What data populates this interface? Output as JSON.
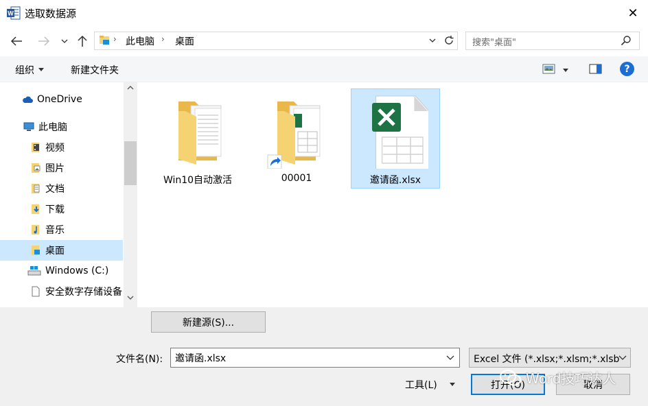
{
  "window": {
    "title": "选取数据源",
    "close_glyph": "✕",
    "app_icon_letter": "W"
  },
  "address": {
    "crumbs": [
      "此电脑",
      "桌面"
    ],
    "search_placeholder": "搜索\"桌面\""
  },
  "toolbar": {
    "organize_label": "组织",
    "new_folder_label": "新建文件夹",
    "help_label": "?"
  },
  "sidebar": {
    "items": [
      {
        "label": "OneDrive",
        "icon": "cloud-icon"
      },
      {
        "label": "此电脑",
        "icon": "computer-icon"
      },
      {
        "label": "视频",
        "icon": "video-folder-icon"
      },
      {
        "label": "图片",
        "icon": "pictures-folder-icon"
      },
      {
        "label": "文档",
        "icon": "documents-folder-icon"
      },
      {
        "label": "下载",
        "icon": "downloads-folder-icon"
      },
      {
        "label": "音乐",
        "icon": "music-folder-icon"
      },
      {
        "label": "桌面",
        "icon": "desktop-folder-icon",
        "selected": true
      },
      {
        "label": "Windows (C:)",
        "icon": "drive-icon"
      },
      {
        "label": "安全数字存储设备",
        "icon": "sd-card-icon"
      }
    ]
  },
  "files": [
    {
      "label": "Win10自动激活",
      "icon": "folder-icon"
    },
    {
      "label": "00001",
      "icon": "shortcut-folder-icon"
    },
    {
      "label": "邀请函.xlsx",
      "icon": "excel-file-icon",
      "selected": true
    }
  ],
  "bottom": {
    "new_source_label": "新建源(S)...",
    "filename_label": "文件名(N):",
    "filename_value": "邀请函.xlsx",
    "filetype_value": "Excel 文件 (*.xlsx;*.xlsm;*.xlsb",
    "tools_label": "工具(L)",
    "open_label": "打开(O)",
    "cancel_label": "取消"
  },
  "watermark": {
    "text": "Word技巧达人"
  },
  "colors": {
    "selection": "#cce8ff",
    "accent": "#0078d7",
    "folder": "#f5d372",
    "excel_green": "#1d7344"
  }
}
